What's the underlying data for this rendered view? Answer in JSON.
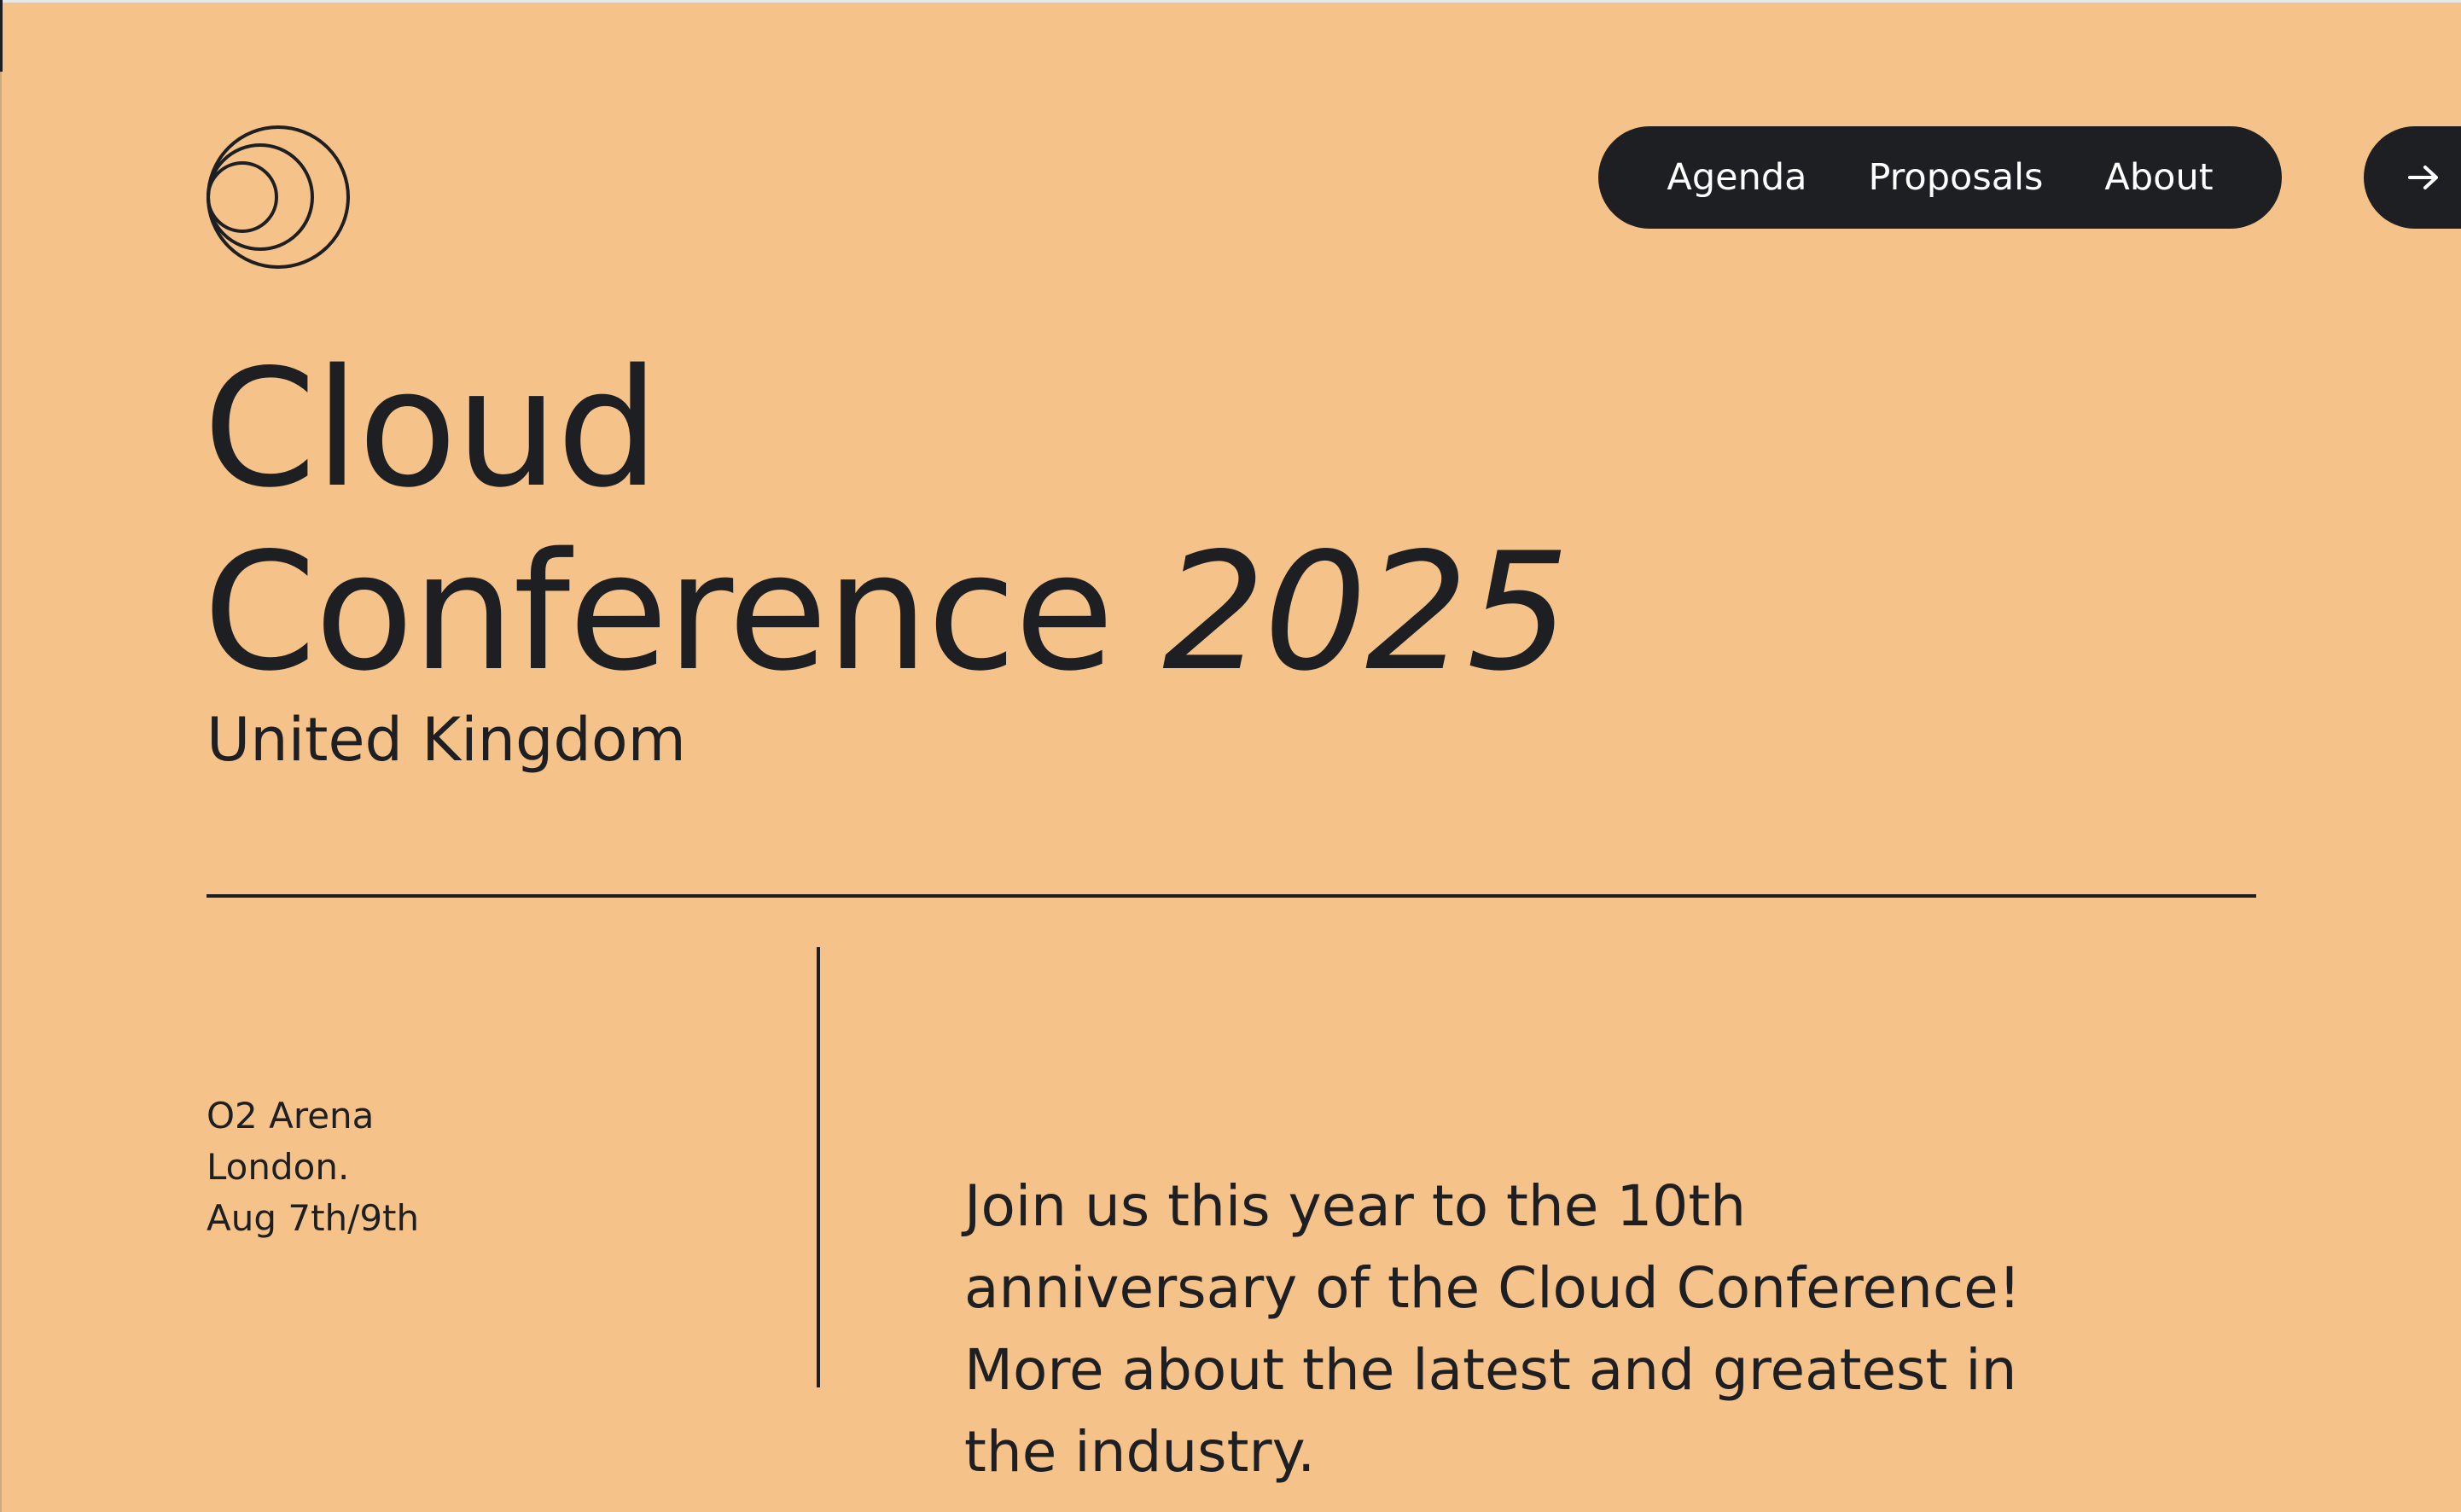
{
  "page": {
    "background_color": "#f5c389",
    "ink_color": "#1e1f23"
  },
  "logo": {
    "icon": "concentric-circles-logo-icon"
  },
  "nav": {
    "links": [
      {
        "label": "Agenda"
      },
      {
        "label": "Proposals"
      },
      {
        "label": "About"
      }
    ],
    "arrow_icon": "arrow-right-icon"
  },
  "hero": {
    "title_line1": "Cloud",
    "title_line2": "Conference",
    "year": "2025",
    "subtitle": "United Kingdom"
  },
  "venue": {
    "place": "O2 Arena",
    "city": "London.",
    "dates": "Aug 7th/9th"
  },
  "intro": {
    "text": "Join us this year to the 10th anniversary of the Cloud Conference! More about the latest and greatest in the industry."
  }
}
